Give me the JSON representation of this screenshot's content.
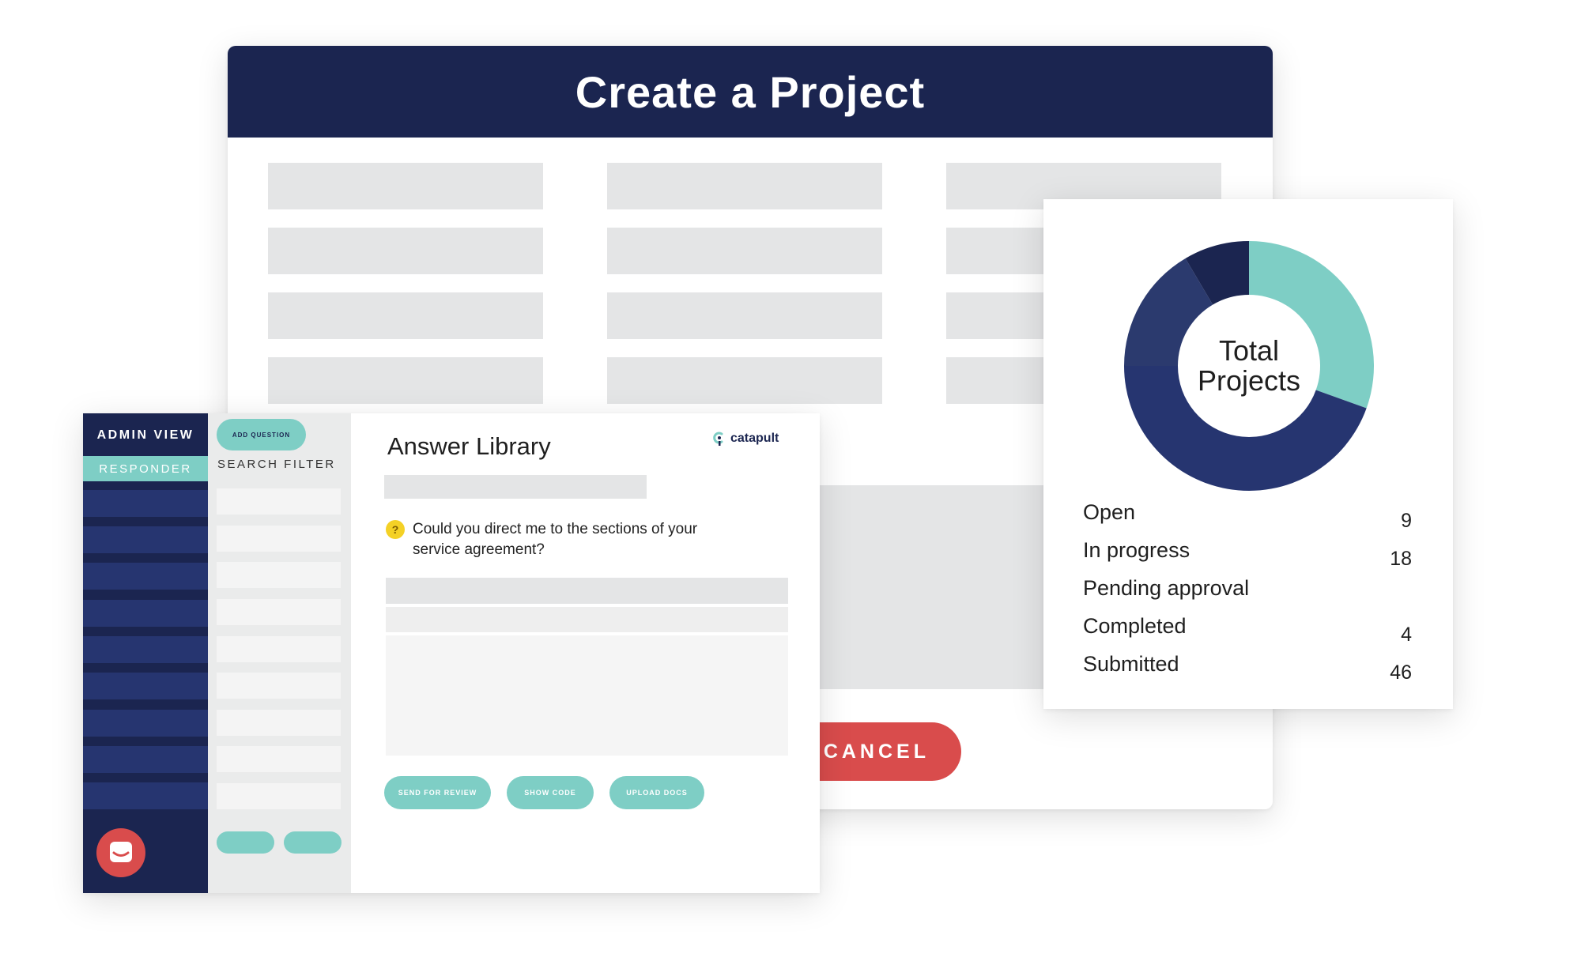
{
  "project_form": {
    "title": "Create a Project",
    "cancel_label": "CANCEL"
  },
  "answer_library": {
    "sidebar": {
      "admin_view": "ADMIN VIEW",
      "responder": "RESPONDER"
    },
    "filter": {
      "add_question_label": "ADD QUESTION",
      "search_filter_label": "SEARCH FILTER"
    },
    "title": "Answer Library",
    "brand": "catapult",
    "question": "Could you direct me to the sections of your service agreement?",
    "question_icon": "?",
    "actions": {
      "send_for_review": "SEND FOR REVIEW",
      "show_code": "SHOW CODE",
      "upload_docs": "UPLOAD DOCS"
    }
  },
  "project_stats": {
    "center_label_line1": "Total",
    "center_label_line2": "Projects",
    "rows": [
      {
        "label": "Open",
        "value": "9"
      },
      {
        "label": "In progress",
        "value": "18"
      },
      {
        "label": "Pending approval",
        "value": ""
      },
      {
        "label": "Completed",
        "value": "4"
      },
      {
        "label": "Submitted",
        "value": "46"
      }
    ]
  },
  "chart_data": {
    "type": "pie",
    "title": "",
    "slices": [
      {
        "color": "#7ecec5",
        "fraction": 0.305
      },
      {
        "color": "#263570",
        "fraction": 0.445
      },
      {
        "color": "#2b3a6e",
        "fraction": 0.165
      },
      {
        "color": "#1b2550",
        "fraction": 0.085
      }
    ]
  },
  "colors": {
    "navy": "#1b2550",
    "teal": "#7ecec5",
    "red": "#d94c4c",
    "yellow": "#f4d126"
  }
}
